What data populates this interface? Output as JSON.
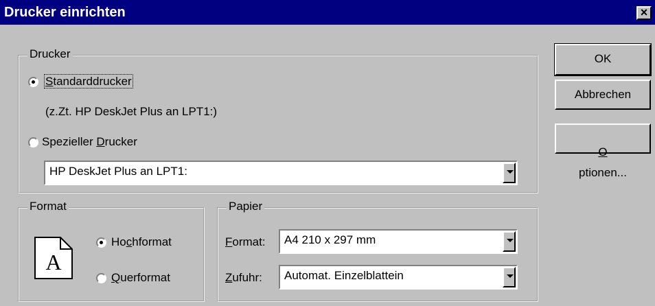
{
  "window": {
    "title": "Drucker einrichten",
    "close_glyph": "×"
  },
  "printer_group": {
    "legend": "Drucker",
    "standard": {
      "pre": "",
      "accel": "S",
      "post": "tandarddrucker",
      "checked": true
    },
    "current_info": "(z.Zt. HP DeskJet Plus an LPT1:)",
    "special": {
      "pre": "Spezieller ",
      "accel": "D",
      "post": "rucker",
      "checked": false
    },
    "printer_select": "HP DeskJet Plus an LPT1:"
  },
  "format_group": {
    "legend": "Format",
    "icon": "page-portrait-icon",
    "icon_letter": "A",
    "portrait": {
      "pre": "Ho",
      "accel": "c",
      "post": "hformat",
      "checked": true
    },
    "landscape": {
      "pre": "",
      "accel": "Q",
      "post": "uerformat",
      "checked": false
    }
  },
  "paper_group": {
    "legend": "Papier",
    "format_label": {
      "pre": "",
      "accel": "F",
      "post": "ormat:"
    },
    "format_value": "A4 210 x 297 mm",
    "feed_label": {
      "pre": "",
      "accel": "Z",
      "post": "ufuhr:"
    },
    "feed_value": "Automat. Einzelblattein"
  },
  "buttons": {
    "ok": "OK",
    "cancel": "Abbrechen",
    "options": {
      "pre": "",
      "accel": "O",
      "post": "ptionen..."
    }
  }
}
